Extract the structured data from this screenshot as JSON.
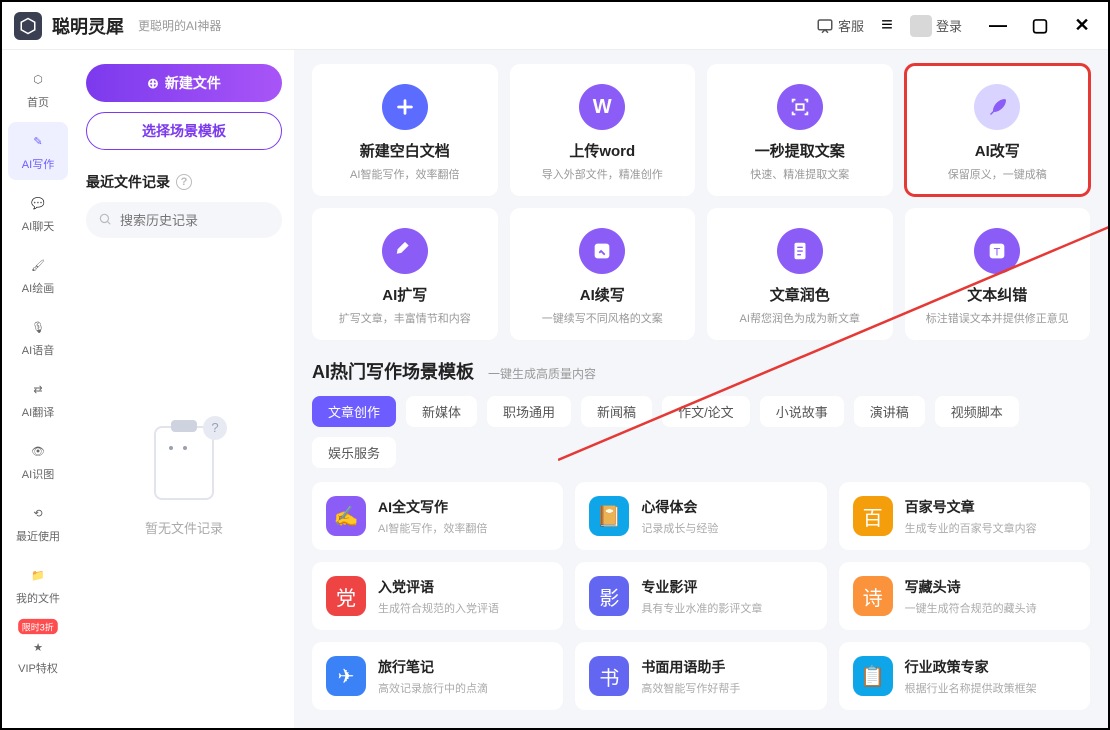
{
  "titlebar": {
    "app_name": "聪明灵犀",
    "subtitle": "更聪明的AI神器",
    "customer_service": "客服",
    "login": "登录"
  },
  "sidebar": {
    "items": [
      {
        "label": "首页"
      },
      {
        "label": "AI写作"
      },
      {
        "label": "AI聊天"
      },
      {
        "label": "AI绘画"
      },
      {
        "label": "AI语音"
      },
      {
        "label": "AI翻译"
      },
      {
        "label": "AI识图"
      },
      {
        "label": "最近使用"
      },
      {
        "label": "我的文件"
      },
      {
        "label": "VIP特权"
      }
    ],
    "badge": "限时3折"
  },
  "leftpanel": {
    "new_file": "新建文件",
    "choose_template": "选择场景模板",
    "recent_section": "最近文件记录",
    "search_placeholder": "搜索历史记录",
    "empty_text": "暂无文件记录"
  },
  "features_row1": [
    {
      "title": "新建空白文档",
      "desc": "AI智能写作，效率翻倍",
      "icon": "plus"
    },
    {
      "title": "上传word",
      "desc": "导入外部文件，精准创作",
      "icon": "word"
    },
    {
      "title": "一秒提取文案",
      "desc": "快速、精准提取文案",
      "icon": "scan"
    },
    {
      "title": "AI改写",
      "desc": "保留原义，一键成稿",
      "icon": "feather",
      "highlighted": true
    }
  ],
  "features_row2": [
    {
      "title": "AI扩写",
      "desc": "扩写文章，丰富情节和内容",
      "icon": "pen"
    },
    {
      "title": "AI续写",
      "desc": "一键续写不同风格的文案",
      "icon": "edit"
    },
    {
      "title": "文章润色",
      "desc": "AI帮您润色为成为新文章",
      "icon": "doc"
    },
    {
      "title": "文本纠错",
      "desc": "标注错误文本并提供修正意见",
      "icon": "check"
    }
  ],
  "section": {
    "title": "AI热门写作场景模板",
    "subtitle": "一键生成高质量内容"
  },
  "tabs": [
    "文章创作",
    "新媒体",
    "职场通用",
    "新闻稿",
    "作文/论文",
    "小说故事",
    "演讲稿",
    "视频脚本",
    "娱乐服务"
  ],
  "active_tab": 0,
  "templates": [
    [
      {
        "title": "AI全文写作",
        "desc": "AI智能写作，效率翻倍",
        "color": "c-purple",
        "glyph": "✍"
      },
      {
        "title": "心得体会",
        "desc": "记录成长与经验",
        "color": "c-cyan",
        "glyph": "📔"
      },
      {
        "title": "百家号文章",
        "desc": "生成专业的百家号文章内容",
        "color": "c-orange",
        "glyph": "百"
      }
    ],
    [
      {
        "title": "入党评语",
        "desc": "生成符合规范的入党评语",
        "color": "c-red",
        "glyph": "党"
      },
      {
        "title": "专业影评",
        "desc": "具有专业水准的影评文章",
        "color": "c-indigo",
        "glyph": "影"
      },
      {
        "title": "写藏头诗",
        "desc": "一键生成符合规范的藏头诗",
        "color": "c-orange2",
        "glyph": "诗"
      }
    ],
    [
      {
        "title": "旅行笔记",
        "desc": "高效记录旅行中的点滴",
        "color": "c-blue2",
        "glyph": "✈"
      },
      {
        "title": "书面用语助手",
        "desc": "高效智能写作好帮手",
        "color": "c-indigo",
        "glyph": "书"
      },
      {
        "title": "行业政策专家",
        "desc": "根据行业名称提供政策框架",
        "color": "c-cyan",
        "glyph": "📋"
      }
    ]
  ]
}
